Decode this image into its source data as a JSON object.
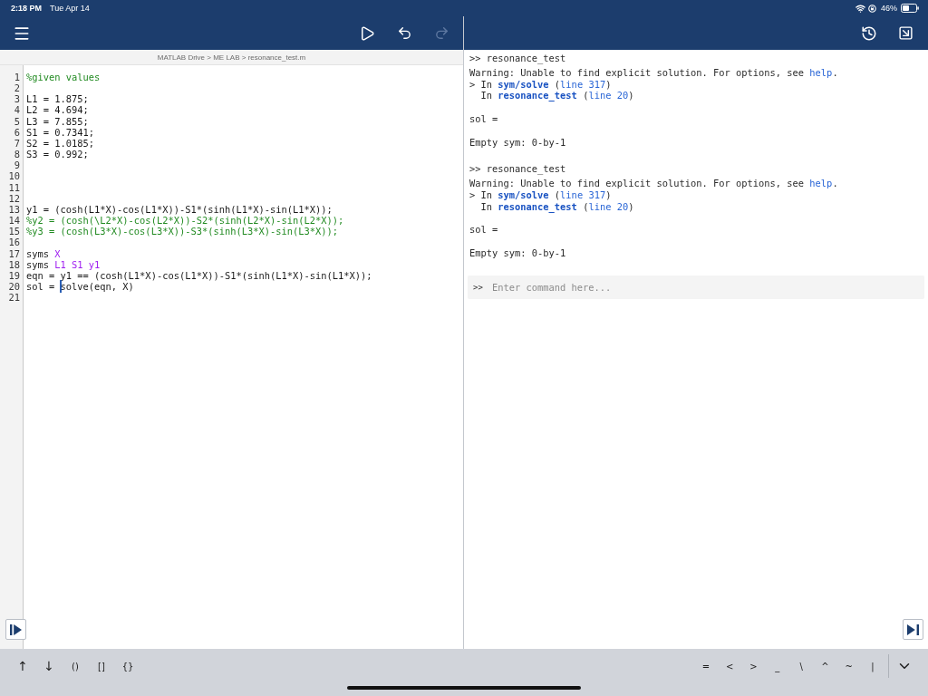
{
  "status_bar": {
    "time": "2:18 PM",
    "date": "Tue Apr 14",
    "battery": "46%"
  },
  "editor": {
    "toolbar": [
      {
        "kind": "run",
        "disabled": false
      },
      {
        "kind": "undo",
        "disabled": false
      },
      {
        "kind": "redo",
        "disabled": true
      }
    ],
    "breadcrumb": "MATLAB Drive > ME LAB > resonance_test.m",
    "lines": [
      {
        "number": "1",
        "segments": [
          {
            "text": "%given values",
            "kind": "comment"
          }
        ]
      },
      {
        "number": "2"
      },
      {
        "number": "3",
        "segments": [
          {
            "text": "L1 = 1.875;",
            "kind": "code"
          }
        ]
      },
      {
        "number": "4",
        "segments": [
          {
            "text": "L2 = 4.694;",
            "kind": "code"
          }
        ]
      },
      {
        "number": "5",
        "segments": [
          {
            "text": "L3 = 7.855;",
            "kind": "code"
          }
        ]
      },
      {
        "number": "6",
        "segments": [
          {
            "text": "S1 = 0.7341;",
            "kind": "code"
          }
        ]
      },
      {
        "number": "7",
        "segments": [
          {
            "text": "S2 = 1.0185;",
            "kind": "code"
          }
        ]
      },
      {
        "number": "8",
        "segments": [
          {
            "text": "S3 = 0.992;",
            "kind": "code"
          }
        ]
      },
      {
        "number": "9"
      },
      {
        "number": "10"
      },
      {
        "number": "11"
      },
      {
        "number": "12"
      },
      {
        "number": "13",
        "segments": [
          {
            "text": "y1 = (cosh(L1*X)-cos(L1*X))-S1*(sinh(L1*X)-sin(L1*X));",
            "kind": "code"
          }
        ]
      },
      {
        "number": "14",
        "segments": [
          {
            "text": "%y2 = (cosh(\\L2*X)-cos(L2*X))-S2*(sinh(L2*X)-sin(L2*X));",
            "kind": "comment"
          }
        ]
      },
      {
        "number": "15",
        "segments": [
          {
            "text": "%y3 = (cosh(L3*X)-cos(L3*X))-S3*(sinh(L3*X)-sin(L3*X));",
            "kind": "comment"
          }
        ]
      },
      {
        "number": "16"
      },
      {
        "number": "17",
        "segments": [
          {
            "text": "syms ",
            "kind": "code"
          },
          {
            "text": "X",
            "kind": "symbol"
          }
        ]
      },
      {
        "number": "18",
        "segments": [
          {
            "text": "syms ",
            "kind": "code"
          },
          {
            "text": "L1 S1 y1",
            "kind": "symbol"
          }
        ]
      },
      {
        "number": "19",
        "segments": [
          {
            "text": "eqn = y1 == (cosh(L1*X)-cos(L1*X))-S1*(sinh(L1*X)-sin(L1*X));",
            "kind": "code"
          }
        ]
      },
      {
        "number": "20",
        "segments": [
          {
            "text": "sol = ",
            "kind": "code"
          },
          {
            "text": "solve(eqn, X)",
            "kind": "code",
            "cursor_before": true
          }
        ]
      },
      {
        "number": "21"
      }
    ]
  },
  "command_window": {
    "entries": [
      {
        "echo": ">> resonance_test",
        "warning": [
          {
            "text": "Warning: Unable to find explicit solution. For options, see ",
            "kind": "text"
          },
          {
            "text": "help",
            "kind": "link"
          },
          {
            "text": ".",
            "kind": "text"
          }
        ],
        "stack": [
          [
            {
              "text": "> In ",
              "kind": "text"
            },
            {
              "text": "sym/solve",
              "kind": "function_link"
            },
            {
              "text": " (",
              "kind": "text"
            },
            {
              "text": "line 317",
              "kind": "link"
            },
            {
              "text": ")",
              "kind": "text"
            }
          ],
          [
            {
              "text": "  In ",
              "kind": "text"
            },
            {
              "text": "resonance_test",
              "kind": "function_link"
            },
            {
              "text": " (",
              "kind": "text"
            },
            {
              "text": "line 20",
              "kind": "link"
            },
            {
              "text": ")",
              "kind": "text"
            }
          ]
        ],
        "output": [
          "sol =",
          "Empty sym: 0-by-1"
        ]
      },
      {
        "echo": ">> resonance_test",
        "warning": [
          {
            "text": "Warning: Unable to find explicit solution. For options, see ",
            "kind": "text"
          },
          {
            "text": "help",
            "kind": "link"
          },
          {
            "text": ".",
            "kind": "text"
          }
        ],
        "stack": [
          [
            {
              "text": "> In ",
              "kind": "text"
            },
            {
              "text": "sym/solve",
              "kind": "function_link"
            },
            {
              "text": " (",
              "kind": "text"
            },
            {
              "text": "line 317",
              "kind": "link"
            },
            {
              "text": ")",
              "kind": "text"
            }
          ],
          [
            {
              "text": "  In ",
              "kind": "text"
            },
            {
              "text": "resonance_test",
              "kind": "function_link"
            },
            {
              "text": " (",
              "kind": "text"
            },
            {
              "text": "line 20",
              "kind": "link"
            },
            {
              "text": ")",
              "kind": "text"
            }
          ]
        ],
        "output": [
          "sol =",
          "Empty sym: 0-by-1"
        ]
      }
    ],
    "input": {
      "prompt": ">>",
      "placeholder": "Enter command here..."
    }
  },
  "accessory_bar": {
    "left_keys": [
      "↑",
      "↓",
      "()",
      "[]",
      "{}"
    ],
    "right_keys": [
      "=",
      "<",
      ">",
      "_",
      "\\",
      "^",
      "~",
      "|"
    ]
  }
}
